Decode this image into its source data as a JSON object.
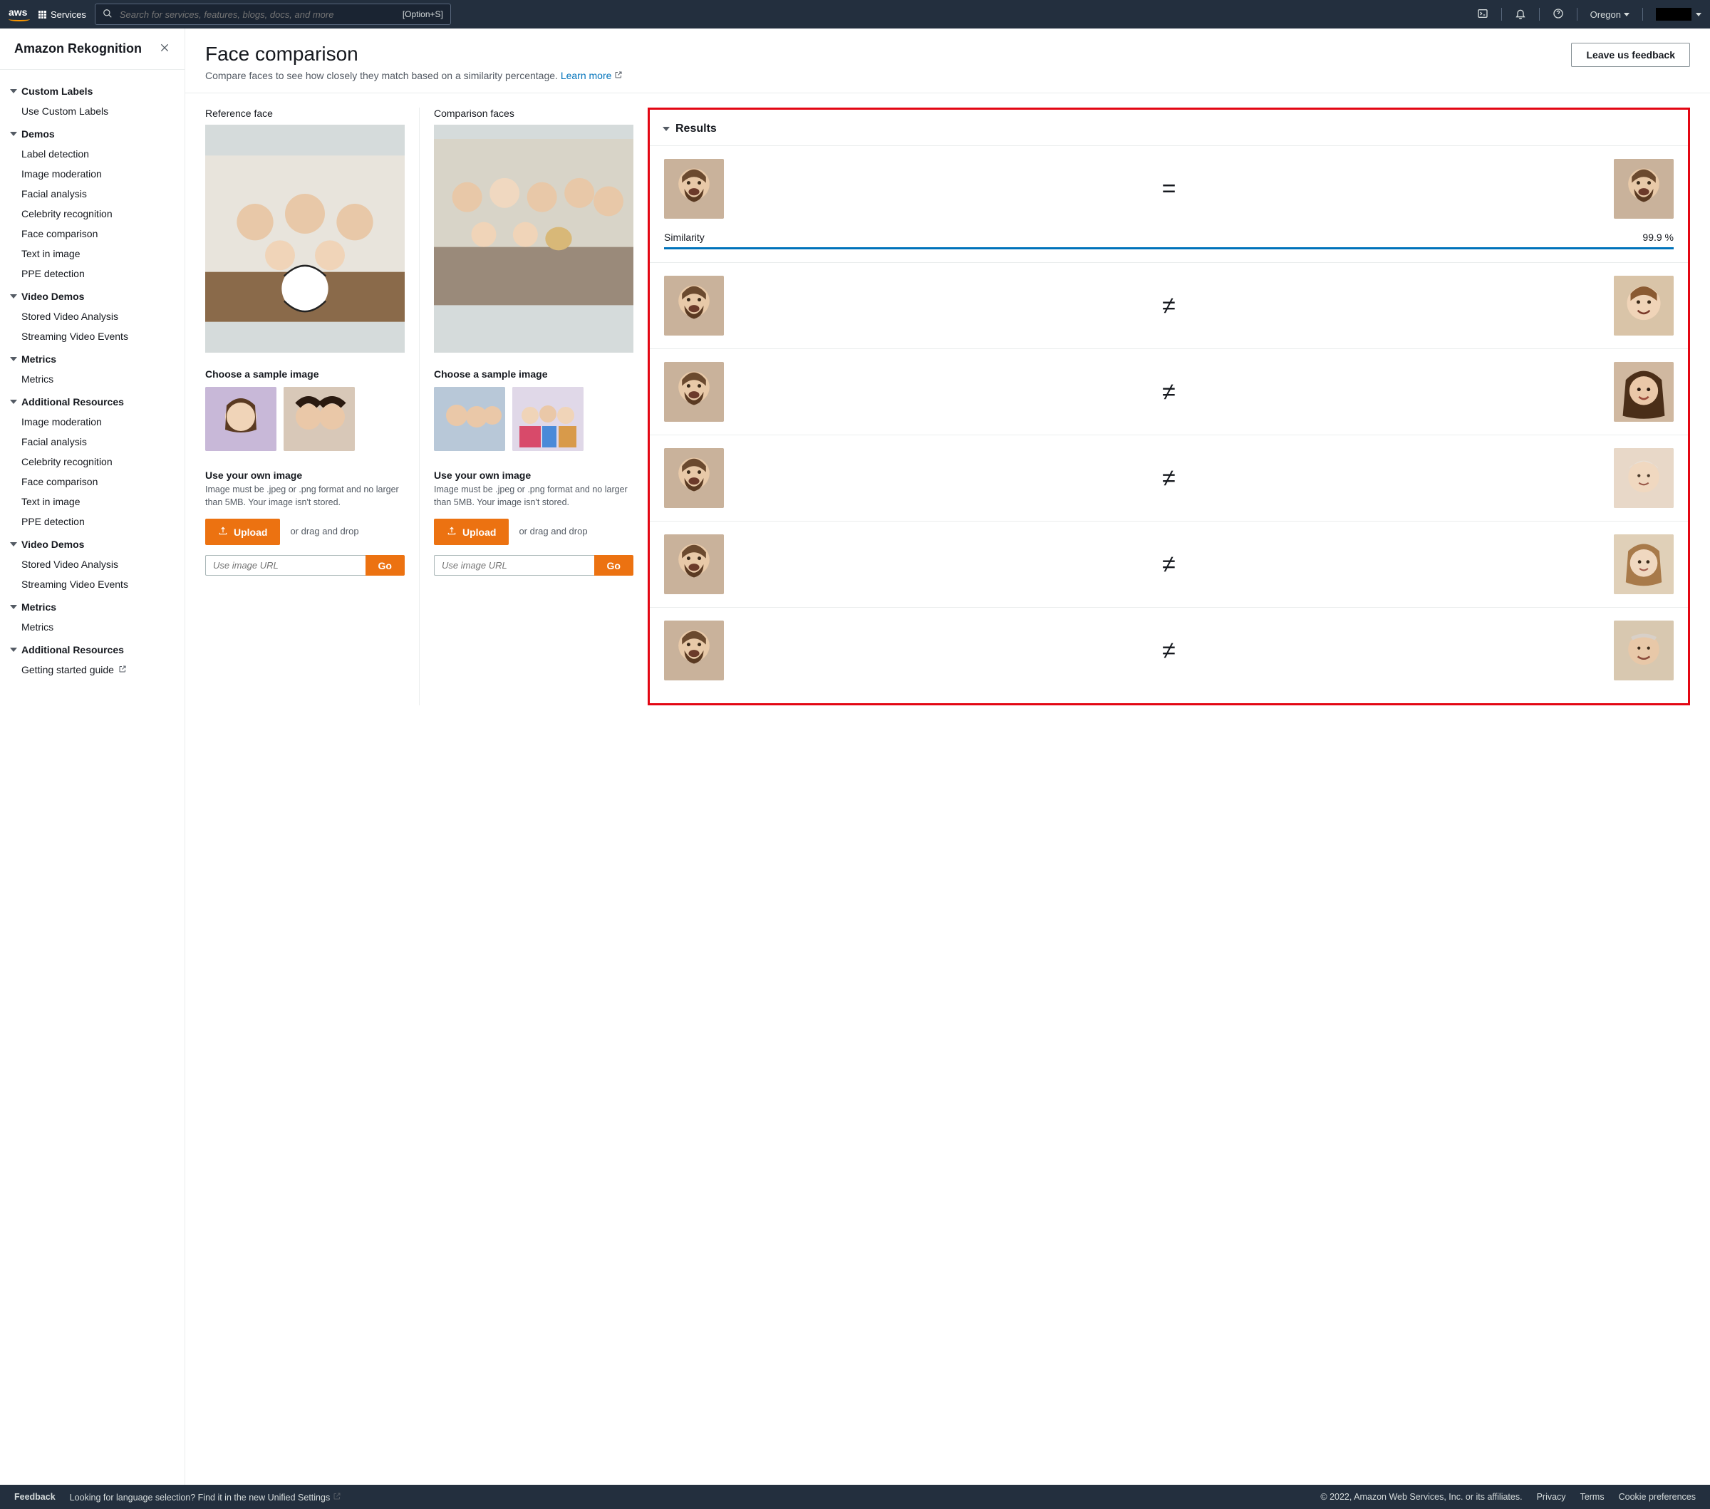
{
  "nav": {
    "services": "Services",
    "search_placeholder": "Search for services, features, blogs, docs, and more",
    "search_hint": "[Option+S]",
    "region": "Oregon"
  },
  "sidebar": {
    "title": "Amazon Rekognition",
    "sections": [
      {
        "heading": "Custom Labels",
        "items": [
          "Use Custom Labels"
        ]
      },
      {
        "heading": "Demos",
        "items": [
          "Label detection",
          "Image moderation",
          "Facial analysis",
          "Celebrity recognition",
          "Face comparison",
          "Text in image",
          "PPE detection"
        ]
      },
      {
        "heading": "Video Demos",
        "items": [
          "Stored Video Analysis",
          "Streaming Video Events"
        ]
      },
      {
        "heading": "Metrics",
        "items": [
          "Metrics"
        ]
      },
      {
        "heading": "Additional Resources",
        "items": [
          "Image moderation",
          "Facial analysis",
          "Celebrity recognition",
          "Face comparison",
          "Text in image",
          "PPE detection"
        ]
      },
      {
        "heading": "Video Demos",
        "items": [
          "Stored Video Analysis",
          "Streaming Video Events"
        ]
      },
      {
        "heading": "Metrics",
        "items": [
          "Metrics"
        ]
      },
      {
        "heading": "Additional Resources",
        "items": [
          "Getting started guide"
        ],
        "ext": true
      }
    ]
  },
  "main": {
    "title": "Face comparison",
    "subtitle": "Compare faces to see how closely they match based on a similarity percentage.",
    "learn": "Learn more",
    "feedback_btn": "Leave us feedback",
    "ref_label": "Reference face",
    "cmp_label": "Comparison faces",
    "sample_h": "Choose a sample image",
    "own_h": "Use your own image",
    "own_p": "Image must be .jpeg or .png format and no larger than 5MB. Your image isn't stored.",
    "upload": "Upload",
    "drag": "or drag and drop",
    "url_ph": "Use image URL",
    "go": "Go"
  },
  "results": {
    "title": "Results",
    "sim_label": "Similarity",
    "sim_value": "99.9 %",
    "rows": [
      {
        "match": true
      },
      {
        "match": false
      },
      {
        "match": false
      },
      {
        "match": false
      },
      {
        "match": false
      },
      {
        "match": false
      }
    ]
  },
  "footer": {
    "feedback": "Feedback",
    "lang": "Looking for language selection? Find it in the new",
    "unified": "Unified Settings",
    "copy": "© 2022, Amazon Web Services, Inc. or its affiliates.",
    "privacy": "Privacy",
    "terms": "Terms",
    "cookie": "Cookie preferences"
  }
}
